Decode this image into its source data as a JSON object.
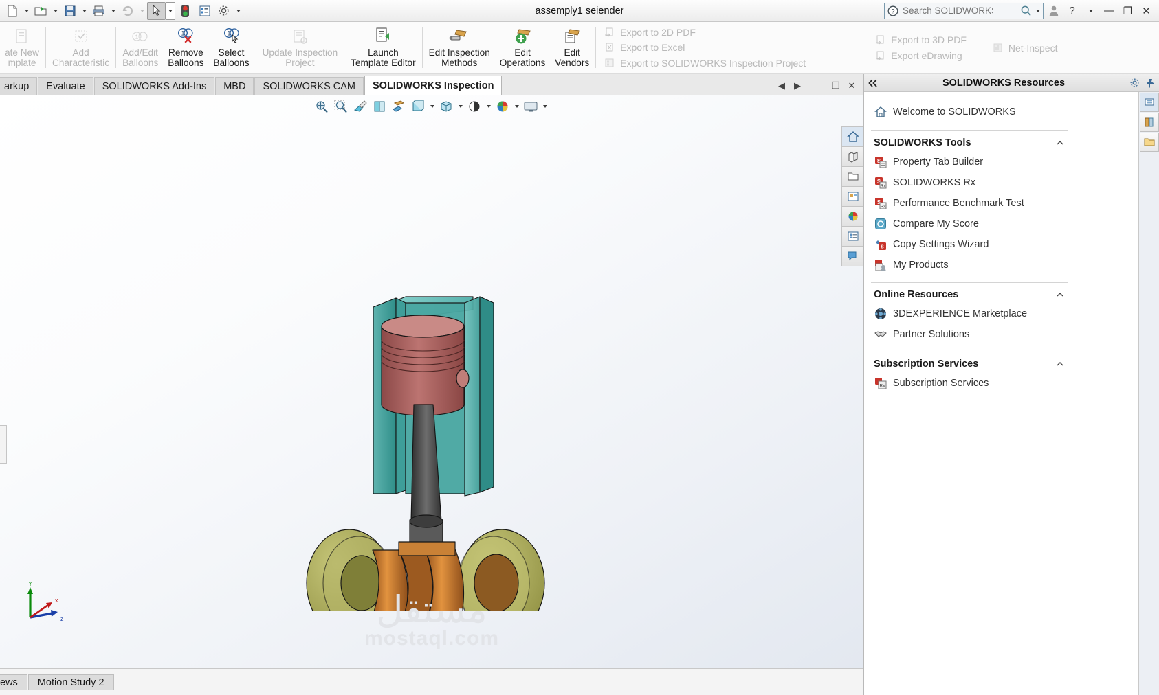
{
  "titlebar": {
    "document_title": "assemply1 seiender",
    "quick_access": [
      {
        "name": "new-document",
        "label": "New",
        "has_caret": true
      },
      {
        "name": "open-document",
        "label": "Open",
        "has_caret": true
      },
      {
        "name": "save-document",
        "label": "Save",
        "has_caret": true
      },
      {
        "name": "print-document",
        "label": "Print",
        "has_caret": true
      },
      {
        "name": "undo",
        "label": "Undo",
        "has_caret": true
      },
      {
        "name": "select",
        "label": "Select",
        "has_caret": true
      },
      {
        "name": "rebuild",
        "label": "Rebuild",
        "has_caret": false
      },
      {
        "name": "file-properties",
        "label": "File Properties",
        "has_caret": false
      },
      {
        "name": "options",
        "label": "Options",
        "has_caret": true
      }
    ],
    "search": {
      "placeholder": "Search SOLIDWORKS Help",
      "value": ""
    },
    "user_icon": "user-account-icon",
    "help_label": "?",
    "window_controls": [
      "minimize",
      "restore",
      "close"
    ]
  },
  "ribbon": {
    "commands": [
      {
        "name": "create-new-template",
        "line1": "ate New",
        "line2": "mplate",
        "icon": "template-icon",
        "enabled": false
      },
      {
        "name": "add-characteristic",
        "line1": "Add",
        "line2": "Characteristic",
        "icon": "characteristic-icon",
        "enabled": false
      },
      {
        "name": "add-edit-balloons",
        "line1": "Add/Edit",
        "line2": "Balloons",
        "icon": "balloon-edit-icon",
        "enabled": false
      },
      {
        "name": "remove-balloons",
        "line1": "Remove",
        "line2": "Balloons",
        "icon": "balloon-remove-icon",
        "enabled": true
      },
      {
        "name": "select-balloons",
        "line1": "Select",
        "line2": "Balloons",
        "icon": "balloon-select-icon",
        "enabled": true
      },
      {
        "name": "update-inspection-project",
        "line1": "Update Inspection",
        "line2": "Project",
        "icon": "update-project-icon",
        "enabled": false
      },
      {
        "name": "launch-template-editor",
        "line1": "Launch",
        "line2": "Template Editor",
        "icon": "template-editor-icon",
        "enabled": true
      },
      {
        "name": "edit-inspection-methods",
        "line1": "Edit Inspection",
        "line2": "Methods",
        "icon": "inspection-methods-icon",
        "enabled": true
      },
      {
        "name": "edit-operations",
        "line1": "Edit",
        "line2": "Operations",
        "icon": "operations-icon",
        "enabled": true
      },
      {
        "name": "edit-vendors",
        "line1": "Edit",
        "line2": "Vendors",
        "icon": "vendors-icon",
        "enabled": true
      }
    ],
    "export_column_1": [
      {
        "name": "export-to-2d-pdf",
        "label": "Export to 2D PDF",
        "icon": "export-pdf-icon",
        "enabled": false
      },
      {
        "name": "export-to-excel",
        "label": "Export to Excel",
        "icon": "export-excel-icon",
        "enabled": false
      },
      {
        "name": "export-to-solidworks-inspection-project",
        "label": "Export to SOLIDWORKS Inspection Project",
        "icon": "export-project-icon",
        "enabled": false
      }
    ],
    "export_column_2": [
      {
        "name": "export-to-3d-pdf",
        "label": "Export to 3D PDF",
        "icon": "export-3dpdf-icon",
        "enabled": false
      },
      {
        "name": "export-edrawing",
        "label": "Export eDrawing",
        "icon": "export-edrawing-icon",
        "enabled": false
      }
    ],
    "export_column_3": [
      {
        "name": "net-inspect",
        "label": "Net-Inspect",
        "icon": "net-inspect-icon",
        "enabled": false
      }
    ]
  },
  "tabs": {
    "items": [
      {
        "name": "tab-markup",
        "label": "arkup",
        "active": false
      },
      {
        "name": "tab-evaluate",
        "label": "Evaluate",
        "active": false
      },
      {
        "name": "tab-solidworks-add-ins",
        "label": "SOLIDWORKS Add-Ins",
        "active": false
      },
      {
        "name": "tab-mbd",
        "label": "MBD",
        "active": false
      },
      {
        "name": "tab-solidworks-cam",
        "label": "SOLIDWORKS CAM",
        "active": false
      },
      {
        "name": "tab-solidworks-inspection",
        "label": "SOLIDWORKS Inspection",
        "active": true
      }
    ],
    "doc_window_controls": [
      {
        "name": "prev-pane-button",
        "glyph": "◀"
      },
      {
        "name": "next-pane-button",
        "glyph": "▶"
      },
      {
        "name": "minimize-document-button",
        "glyph": "—"
      },
      {
        "name": "restore-document-button",
        "glyph": "❐"
      },
      {
        "name": "close-document-button",
        "glyph": "✕"
      }
    ]
  },
  "graphics": {
    "view_toolbar": [
      {
        "name": "zoom-to-fit-icon",
        "caret": false
      },
      {
        "name": "zoom-to-area-icon",
        "caret": false
      },
      {
        "name": "previous-view-icon",
        "caret": false
      },
      {
        "name": "section-view-icon",
        "caret": false
      },
      {
        "name": "view-orientation-icon",
        "caret": false
      },
      {
        "name": "display-style-icon",
        "caret": true
      },
      {
        "name": "hide-show-items-icon",
        "caret": true
      },
      {
        "name": "edit-appearance-icon",
        "caret": true
      },
      {
        "name": "apply-scene-icon",
        "caret": true
      },
      {
        "name": "view-settings-icon",
        "caret": true
      }
    ],
    "right_tabs": [
      {
        "name": "view-heads-up-home-icon"
      },
      {
        "name": "appearances-icon"
      },
      {
        "name": "folder-icon"
      },
      {
        "name": "display-manager-icon"
      },
      {
        "name": "scene-icon"
      },
      {
        "name": "custom-properties-icon"
      },
      {
        "name": "notes-icon"
      }
    ],
    "triad": {
      "x_label": "x",
      "y_label": "Y",
      "z_label": "z"
    },
    "watermark": {
      "arabic": "مستقل",
      "latin": "mostaql.com"
    },
    "model": {
      "name": "piston-crankshaft-assembly",
      "colors": {
        "cylinder_block": "#49a09b",
        "piston": "#a85a58",
        "connecting_rod": "#4a4a4a",
        "crank_web": "#c8762e",
        "flywheel": "#a8a84f",
        "outline": "#1a1a1a"
      }
    }
  },
  "task_pane": {
    "title": "SOLIDWORKS Resources",
    "collapse_icon": "collapse-left-icon",
    "settings_icon": "gear-icon",
    "pin_icon": "pin-icon",
    "welcome": {
      "name": "welcome-to-solidworks",
      "label": "Welcome to SOLIDWORKS",
      "icon": "home-icon"
    },
    "sections": [
      {
        "name": "solidworks-tools",
        "title": "SOLIDWORKS Tools",
        "expanded": true,
        "items": [
          {
            "name": "property-tab-builder",
            "label": "Property Tab Builder",
            "icon": "sw-red-box-icon"
          },
          {
            "name": "solidworks-rx",
            "label": "SOLIDWORKS Rx",
            "icon": "sw-rx-icon"
          },
          {
            "name": "performance-benchmark-test",
            "label": "Performance Benchmark Test",
            "icon": "sw-rx-icon"
          },
          {
            "name": "compare-my-score",
            "label": "Compare My Score",
            "icon": "compare-icon"
          },
          {
            "name": "copy-settings-wizard",
            "label": "Copy Settings Wizard",
            "icon": "copy-settings-icon"
          },
          {
            "name": "my-products",
            "label": "My Products",
            "icon": "my-products-icon"
          }
        ]
      },
      {
        "name": "online-resources",
        "title": "Online Resources",
        "expanded": true,
        "items": [
          {
            "name": "3dexperience-marketplace",
            "label": "3DEXPERIENCE Marketplace",
            "icon": "marketplace-icon"
          },
          {
            "name": "partner-solutions",
            "label": "Partner Solutions",
            "icon": "handshake-icon"
          }
        ]
      },
      {
        "name": "subscription-services",
        "title": "Subscription Services",
        "expanded": true,
        "items": [
          {
            "name": "subscription-services-link",
            "label": "Subscription Services",
            "icon": "subscription-icon"
          }
        ]
      }
    ],
    "side_tabs": [
      {
        "name": "solidworks-resources-tab-icon"
      },
      {
        "name": "design-library-tab-icon"
      },
      {
        "name": "file-explorer-tab-icon"
      }
    ]
  },
  "bottom_bar": {
    "tabs": [
      {
        "name": "bottom-tab-3d-views",
        "label": "ews",
        "active": false
      },
      {
        "name": "bottom-tab-motion-study-2",
        "label": "Motion Study 2",
        "active": false
      }
    ]
  }
}
